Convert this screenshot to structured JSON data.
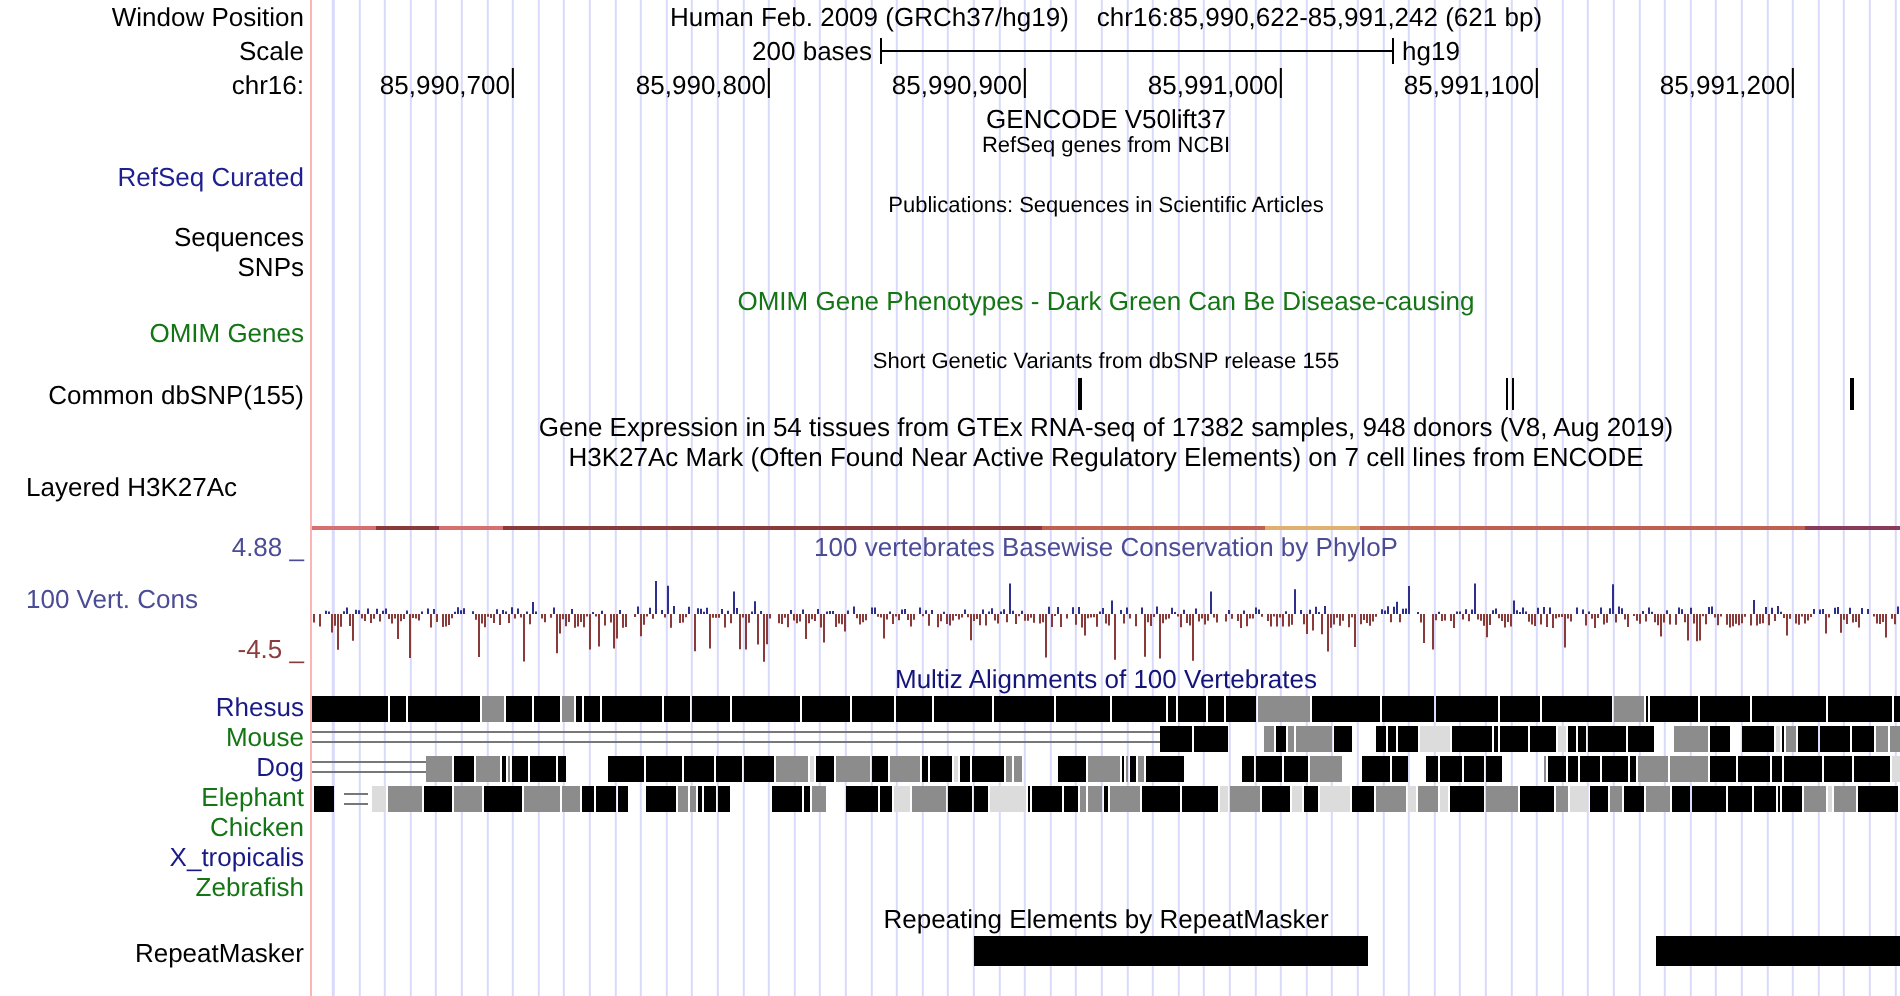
{
  "rows": [
    {
      "kind": "position",
      "label": "Window Position",
      "title": "Human Feb. 2009 (GRCh37/hg19)",
      "detail": "chr16:85,990,622-85,991,242 (621 bp)"
    },
    {
      "kind": "scale",
      "label": "Scale",
      "title": "200 bases",
      "detail": "hg19"
    },
    {
      "kind": "ruler",
      "label": "chr16:",
      "ticks": [
        "85,990,700",
        "85,990,800",
        "85,990,900",
        "85,991,000",
        "85,991,100",
        "85,991,200"
      ]
    },
    {
      "kind": "title",
      "title": "GENCODE V50lift37"
    },
    {
      "kind": "note",
      "title": "RefSeq genes from NCBI"
    },
    {
      "kind": "label",
      "label": "RefSeq Curated",
      "color": "#1f1f8f"
    },
    {
      "kind": "note",
      "title": "Publications: Sequences in Scientific Articles"
    },
    {
      "kind": "label",
      "label": "Sequences"
    },
    {
      "kind": "label",
      "label": "SNPs"
    },
    {
      "kind": "title",
      "title": "OMIM Gene Phenotypes - Dark Green Can Be Disease-causing",
      "color": "#137513"
    },
    {
      "kind": "label",
      "label": "OMIM Genes",
      "color": "#137513"
    },
    {
      "kind": "note",
      "title": "Short Genetic Variants from dbSNP release 155"
    },
    {
      "kind": "snps",
      "label": "Common dbSNP(155)"
    },
    {
      "kind": "title",
      "title": "Gene Expression in 54 tissues from GTEx RNA-seq of 17382 samples, 948 donors (V8, Aug 2019)"
    },
    {
      "kind": "title",
      "title": "H3K27Ac Mark (Often Found Near Active Regulatory Elements) on 7 cell lines from ENCODE"
    },
    {
      "kind": "layered",
      "label": "Layered H3K27Ac"
    },
    {
      "kind": "conservation",
      "title": "100 vertebrates Basewise Conservation by PhyloP",
      "label": "100 Vert. Cons",
      "max": "4.88 _",
      "min": "-4.5 _",
      "color": "#4c4c96"
    },
    {
      "kind": "title",
      "title": "Multiz Alignments of 100 Vertebrates",
      "color": "#14147a"
    },
    {
      "kind": "species",
      "label": "Rhesus",
      "color": "#1a1a86"
    },
    {
      "kind": "species",
      "label": "Mouse",
      "color": "#137513"
    },
    {
      "kind": "species",
      "label": "Dog",
      "color": "#1a1a86"
    },
    {
      "kind": "species",
      "label": "Elephant",
      "color": "#137513"
    },
    {
      "kind": "species",
      "label": "Chicken",
      "color": "#137513"
    },
    {
      "kind": "species",
      "label": "X_tropicalis",
      "color": "#1a1a86"
    },
    {
      "kind": "species",
      "label": "Zebrafish",
      "color": "#137513"
    },
    {
      "kind": "title",
      "title": "Repeating Elements by RepeatMasker"
    },
    {
      "kind": "repeats",
      "label": "RepeatMasker"
    }
  ]
}
